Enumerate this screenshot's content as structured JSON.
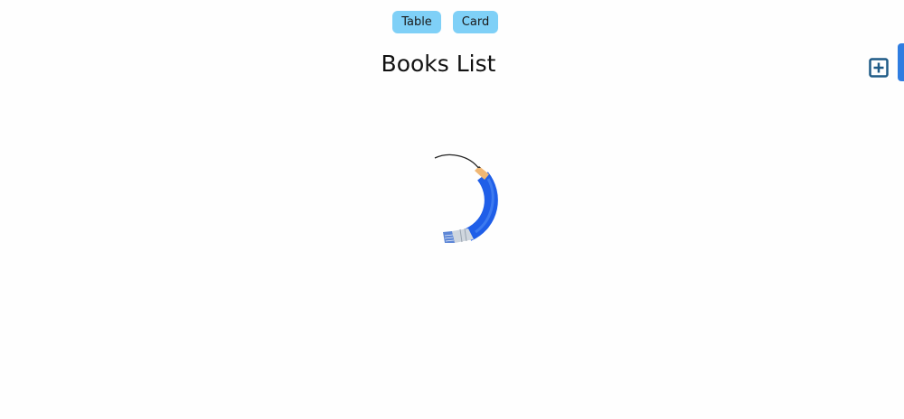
{
  "view_toggle": {
    "table_label": "Table",
    "card_label": "Card"
  },
  "header": {
    "title": "Books List"
  },
  "icons": {
    "add": "add-square-icon",
    "loader": "pencil-loader-icon"
  },
  "colors": {
    "toggle_bg": "#7fd0f7",
    "accent": "#2f7de1",
    "pencil_body": "#1f5ee8",
    "add_icon": "#1e5a86"
  }
}
